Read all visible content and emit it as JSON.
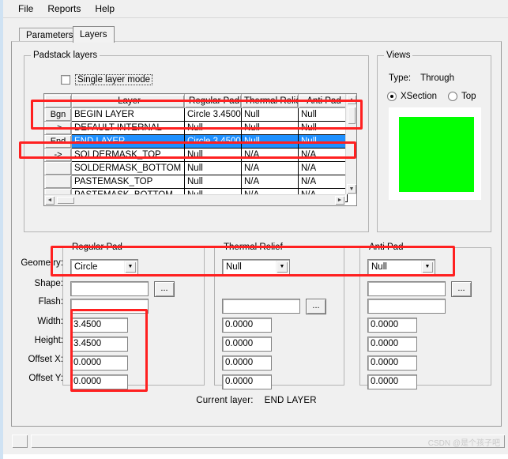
{
  "menu": {
    "items": [
      {
        "label": "File"
      },
      {
        "label": "Reports"
      },
      {
        "label": "Help"
      }
    ]
  },
  "tabs": [
    {
      "label": "Parameters",
      "active": false
    },
    {
      "label": "Layers",
      "active": true
    }
  ],
  "padstack_layers": {
    "group_title": "Padstack layers",
    "single_layer_mode": {
      "label": "Single layer mode",
      "checked": false
    },
    "grid": {
      "columns": [
        "",
        "Layer",
        "Regular Pad",
        "Thermal Relief",
        "Anti Pad"
      ],
      "rows": [
        {
          "marker": "Bgn",
          "layer": "BEGIN LAYER",
          "regular": "Circle 3.4500",
          "thermal": "Null",
          "anti": "Null",
          "selected": false
        },
        {
          "marker": "->",
          "layer": "DEFAULT INTERNAL",
          "regular": "Null",
          "thermal": "Null",
          "anti": "Null",
          "selected": false
        },
        {
          "marker": "End",
          "layer": "END LAYER",
          "regular": "Circle 3.4500",
          "thermal": "Null",
          "anti": "Null",
          "selected": true
        },
        {
          "marker": "->",
          "layer": "SOLDERMASK_TOP",
          "regular": "Null",
          "thermal": "N/A",
          "anti": "N/A",
          "selected": false
        },
        {
          "marker": "",
          "layer": "SOLDERMASK_BOTTOM",
          "regular": "Null",
          "thermal": "N/A",
          "anti": "N/A",
          "selected": false
        },
        {
          "marker": "",
          "layer": "PASTEMASK_TOP",
          "regular": "Null",
          "thermal": "N/A",
          "anti": "N/A",
          "selected": false
        },
        {
          "marker": "",
          "layer": "PASTEMASK_BOTTOM",
          "regular": "Null",
          "thermal": "N/A",
          "anti": "N/A",
          "selected": false
        }
      ]
    }
  },
  "views": {
    "group_title": "Views",
    "type_label": "Type:",
    "type_value": "Through",
    "radios": [
      {
        "label": "XSection",
        "selected": true
      },
      {
        "label": "Top",
        "selected": false
      }
    ],
    "preview_color": "#00FF00",
    "preview_bg": "#FFFFFF"
  },
  "field_labels": [
    "Geometry:",
    "Shape:",
    "Flash:",
    "Width:",
    "Height:",
    "Offset X:",
    "Offset Y:"
  ],
  "regular_pad": {
    "group_title": "Regular Pad",
    "geometry": "Circle",
    "shape": "",
    "flash": "",
    "width": "3.4500",
    "height": "3.4500",
    "offset_x": "0.0000",
    "offset_y": "0.0000",
    "browse_label": "..."
  },
  "thermal_relief": {
    "group_title": "Thermal Relief",
    "geometry": "Null",
    "shape": "",
    "flash": "",
    "width": "0.0000",
    "height": "0.0000",
    "offset_x": "0.0000",
    "offset_y": "0.0000",
    "browse_label": "..."
  },
  "anti_pad": {
    "group_title": "Anti Pad",
    "geometry": "Null",
    "shape": "",
    "flash": "",
    "width": "0.0000",
    "height": "0.0000",
    "offset_x": "0.0000",
    "offset_y": "0.0000",
    "browse_label": "..."
  },
  "current_layer": {
    "label": "Current layer:",
    "value": "END LAYER"
  },
  "status_bar": {
    "text": "",
    "watermark": "CSDN @是个孩子吧"
  },
  "icons": {
    "combo_arrow": "▼",
    "scroll_up": "▲",
    "scroll_down": "▼",
    "scroll_left": "◄",
    "scroll_right": "►"
  }
}
